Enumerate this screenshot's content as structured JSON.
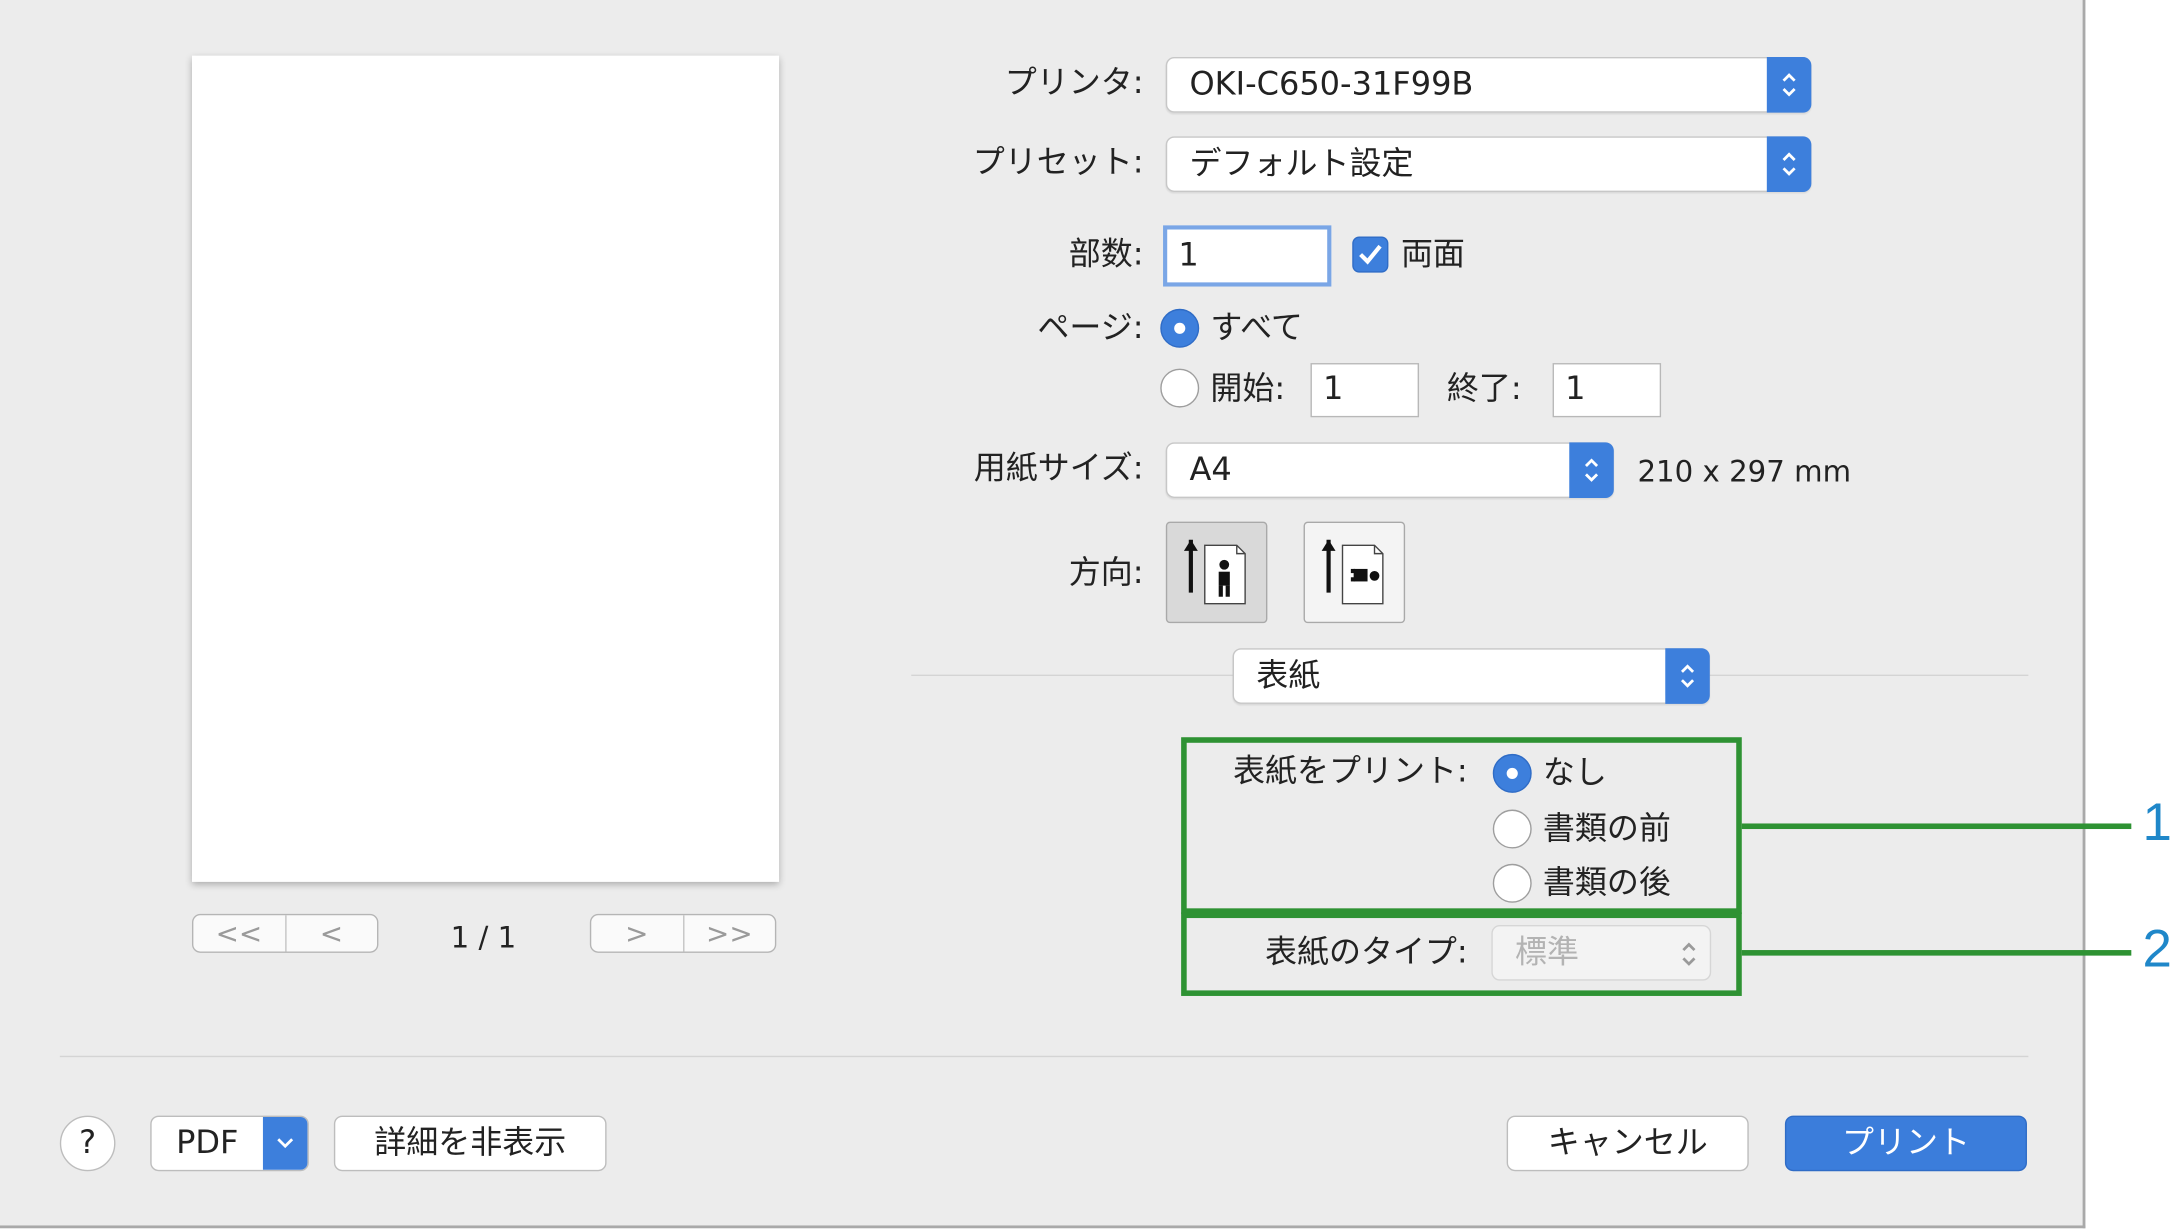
{
  "printer": {
    "label": "プリンタ:",
    "value": "OKI-C650-31F99B"
  },
  "preset": {
    "label": "プリセット:",
    "value": "デフォルト設定"
  },
  "copies": {
    "label": "部数:",
    "value": "1",
    "duplex_label": "両面",
    "duplex_checked": true
  },
  "pages": {
    "label": "ページ:",
    "all_label": "すべて",
    "from_label": "開始:",
    "from_value": "1",
    "to_label": "終了:",
    "to_value": "1"
  },
  "paper_size": {
    "label": "用紙サイズ:",
    "value": "A4",
    "dimensions": "210 x 297 mm"
  },
  "orientation": {
    "label": "方向:"
  },
  "section_menu": {
    "value": "表紙"
  },
  "cover_print": {
    "label": "表紙をプリント:",
    "options": [
      "なし",
      "書類の前",
      "書類の後"
    ],
    "selected": "なし"
  },
  "cover_type": {
    "label": "表紙のタイプ:",
    "value": "標準"
  },
  "preview_nav": {
    "first": "<<",
    "prev": "<",
    "page_indicator": "1 / 1",
    "next": ">",
    "last": ">>"
  },
  "footer": {
    "help": "?",
    "pdf": "PDF",
    "hide_details": "詳細を非表示",
    "cancel": "キャンセル",
    "print": "プリント"
  },
  "callouts": [
    "1",
    "2"
  ],
  "colors": {
    "accent": "#3d7fdc",
    "highlight_box": "#2e9233",
    "callout_number": "#1f87c9"
  }
}
